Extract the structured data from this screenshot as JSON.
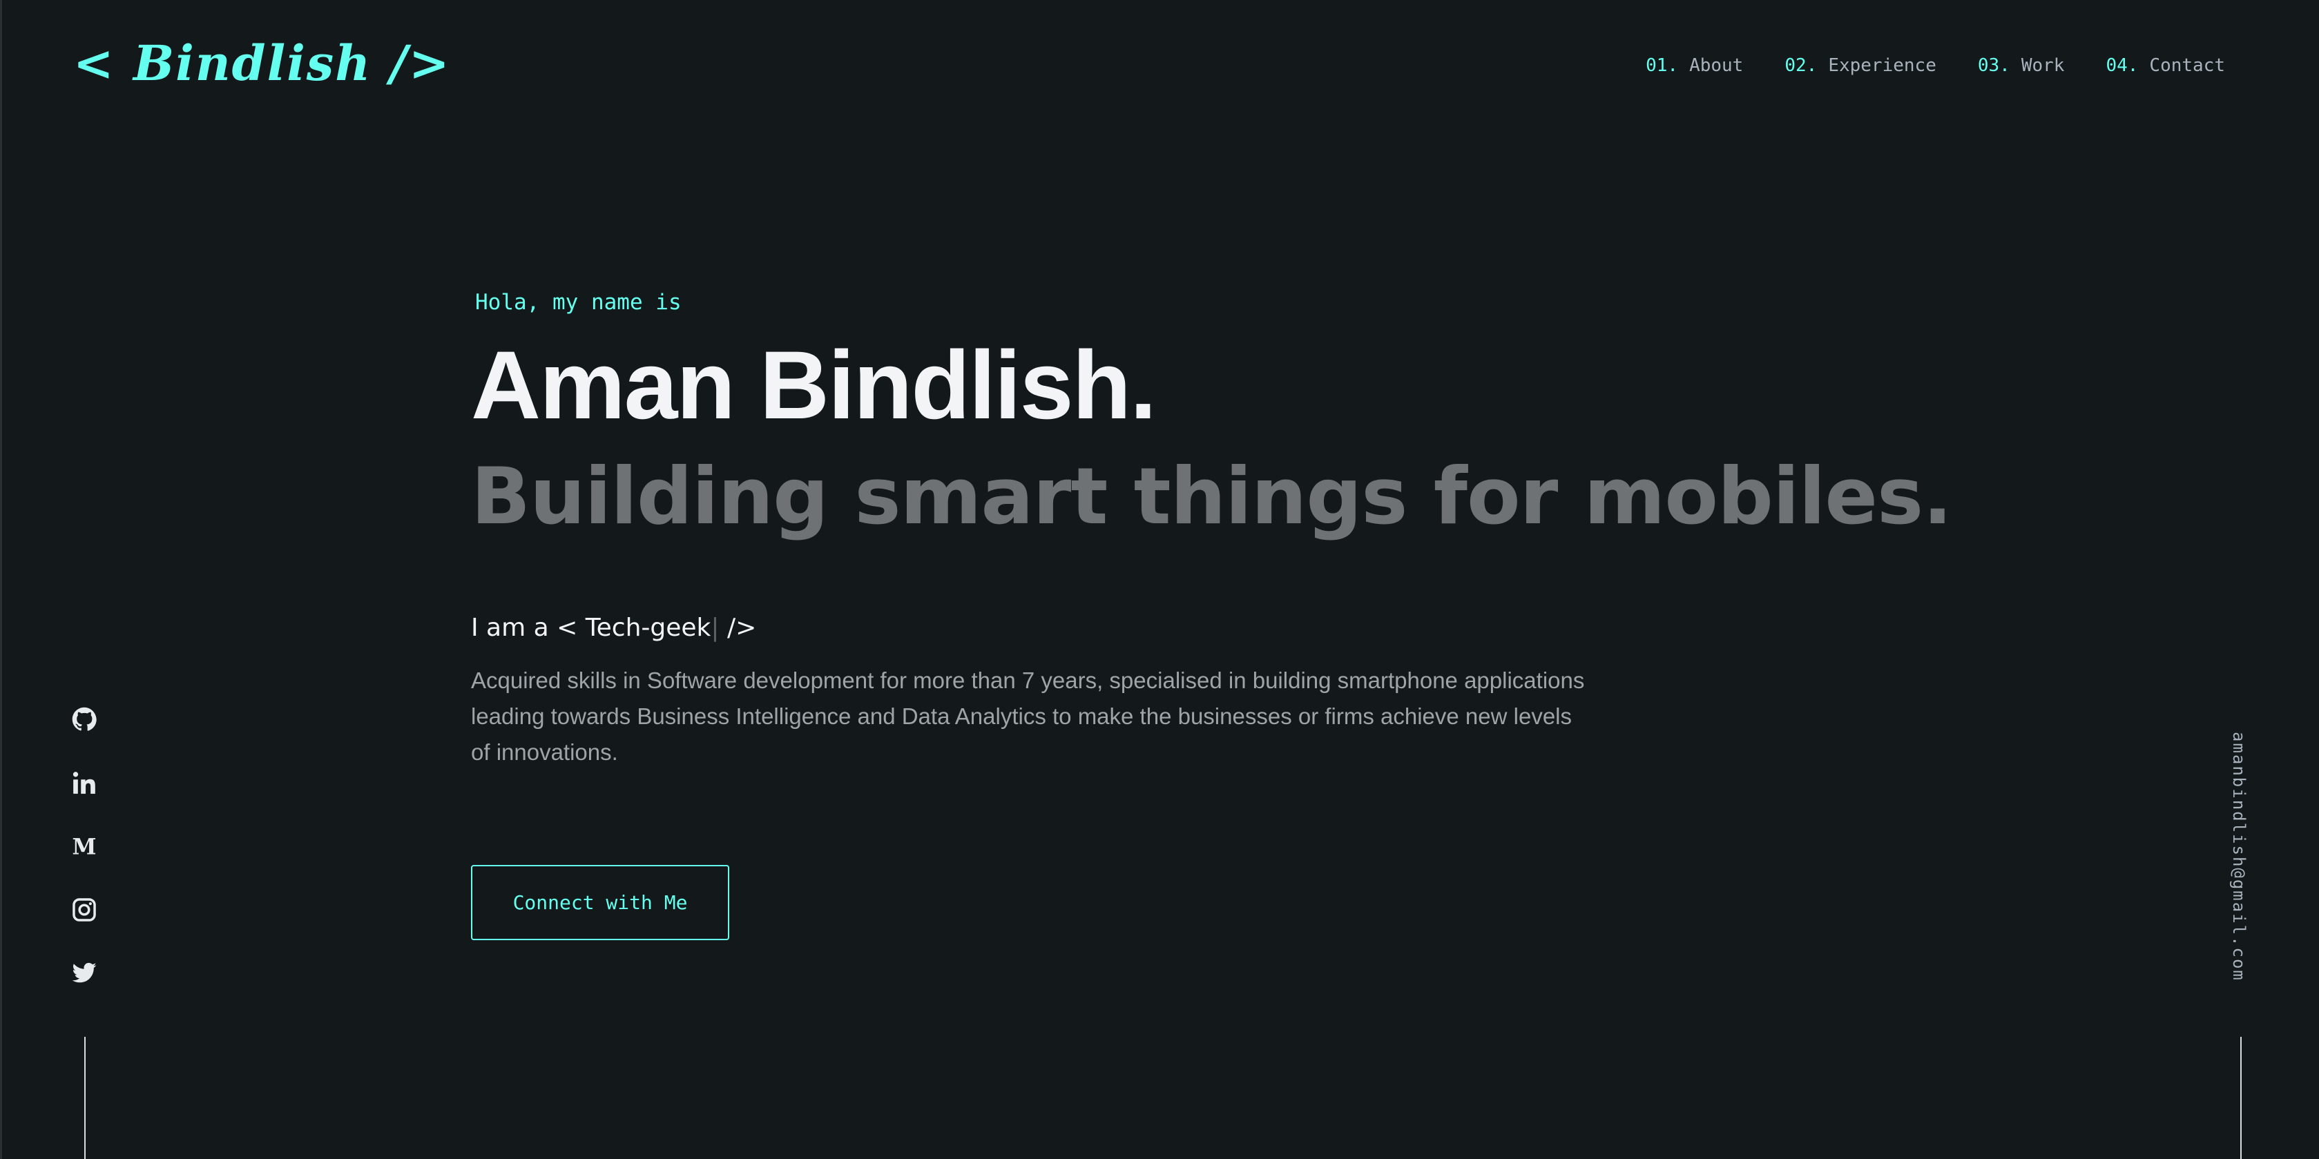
{
  "brand": {
    "logo_text": "< Bindlish />"
  },
  "nav": [
    {
      "num": "01.",
      "label": "About"
    },
    {
      "num": "02.",
      "label": "Experience"
    },
    {
      "num": "03.",
      "label": "Work"
    },
    {
      "num": "04.",
      "label": "Contact"
    }
  ],
  "hero": {
    "greeting": "Hola, my name is",
    "name": "Aman Bindlish.",
    "tagline": "Building smart things for mobiles.",
    "role_prefix": "I am a < ",
    "role_word": "Tech-geek",
    "role_cursor": "|",
    "role_suffix": " />",
    "description": "Acquired skills in Software development for more than 7 years, specialised in building smartphone applications leading towards Business Intelligence and Data Analytics to make the businesses or firms achieve new levels of innovations.",
    "cta_label": "Connect with Me"
  },
  "socials": [
    "github-icon",
    "linkedin-icon",
    "medium-icon",
    "instagram-icon",
    "twitter-icon"
  ],
  "email": "amanbindlish@gmail.com",
  "colors": {
    "background": "#13181b",
    "accent": "#64ffee",
    "heading": "#f2f4f6",
    "muted_heading": "#6f7274",
    "body_text": "#9ea4a8"
  }
}
